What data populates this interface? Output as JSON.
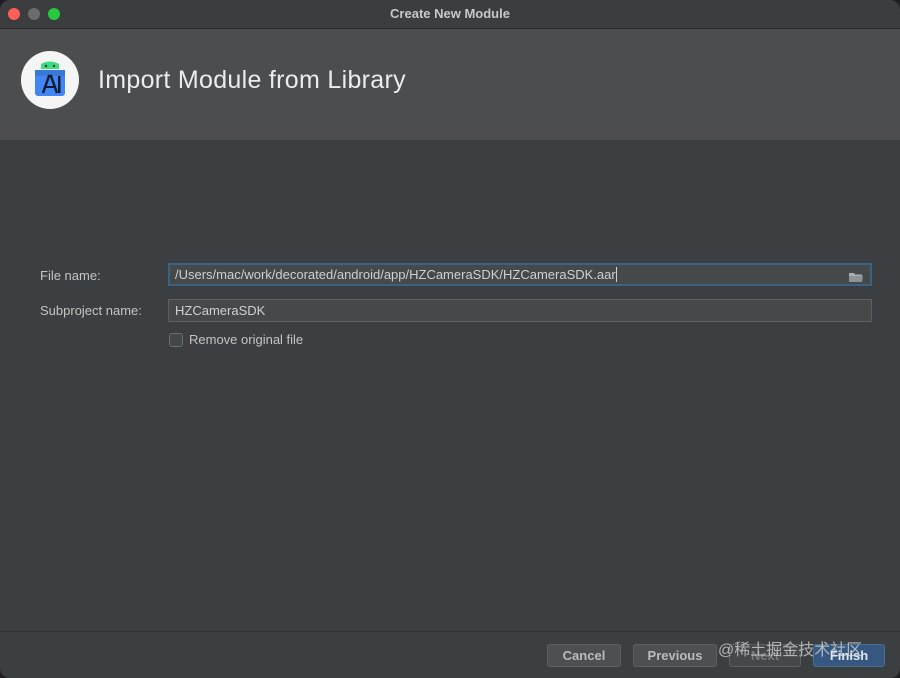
{
  "window": {
    "title": "Create New Module"
  },
  "header": {
    "title": "Import Module from Library"
  },
  "form": {
    "file_name_label": "File name:",
    "file_name_value": "/Users/mac/work/decorated/android/app/HZCameraSDK/HZCameraSDK.aar",
    "subproject_label": "Subproject name:",
    "subproject_value": "HZCameraSDK",
    "remove_original_label": "Remove original file",
    "remove_original_checked": false
  },
  "footer": {
    "cancel": "Cancel",
    "previous": "Previous",
    "next": "Next",
    "finish": "Finish"
  },
  "watermark": "@稀土掘金技术社区",
  "colors": {
    "close": "#ff5f57",
    "minimize": "#6c6c6c",
    "maximize": "#28c840",
    "primary_button": "#365880",
    "focus_border": "#3d6185"
  },
  "icons": {
    "logo": "android-studio-logo",
    "browse": "folder-icon"
  }
}
